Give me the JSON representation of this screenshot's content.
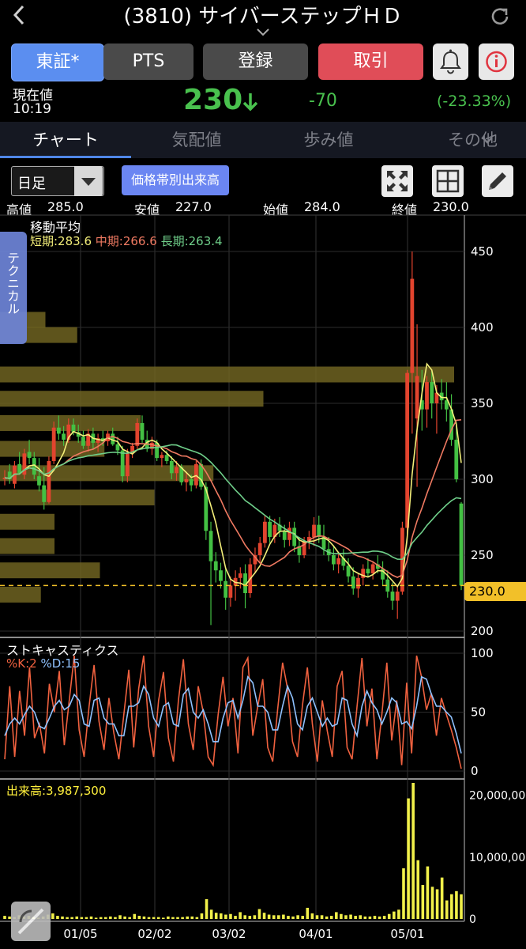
{
  "nav": {
    "back_icon": "chevron-left-icon",
    "title": "(3810) サイバーステップＨＤ",
    "refresh_icon": "refresh-icon",
    "expand_icon": "chevron-down-icon"
  },
  "market_buttons": {
    "tosho": "東証*",
    "pts": "PTS",
    "register": "登録",
    "trade": "取引"
  },
  "icons": {
    "bell": "bell-icon",
    "info": "info-icon"
  },
  "quote": {
    "label": "現在値",
    "time": "10:19",
    "price": "230",
    "direction": "down",
    "change": "-70",
    "change_pct": "(-23.33%)"
  },
  "tabs": [
    "チャート",
    "気配値",
    "歩み値",
    "その他"
  ],
  "toolbar": {
    "period": "日足",
    "volume_by_price": "価格帯別出来高"
  },
  "ohlc": {
    "high_label": "高値",
    "high": "285.0",
    "low_label": "安値",
    "low": "227.0",
    "open_label": "始値",
    "open": "284.0",
    "close_label": "終値",
    "close": "230.0"
  },
  "technical_tab": "テクニカル",
  "moving_average": {
    "title": "移動平均",
    "short": "短期:283.6",
    "mid": "中期:266.6",
    "long": "長期:263.4"
  },
  "stochastics": {
    "title": "ストキャスティクス",
    "k": "%K:2",
    "d": "%D:15"
  },
  "volume": {
    "title": "出来高:3,987,300"
  },
  "colors": {
    "up": "#e2442e",
    "down": "#43c043",
    "ma_short": "#f4ef7a",
    "ma_mid": "#f07a62",
    "ma_long": "#6fcf8a",
    "accent": "#5b8ef0",
    "volume_bar": "#f1f04a",
    "vp_bar": "#6f6321"
  },
  "chart_data": [
    {
      "type": "candlestick",
      "title": "",
      "ylim": [
        195,
        460
      ],
      "y_ticks": [
        "450",
        "400",
        "350",
        "300",
        "250",
        "200"
      ],
      "x_ticks": [
        "01/05",
        "02/02",
        "03/02",
        "04/01",
        "05/01"
      ],
      "current_price_label": "230.0",
      "candles": [
        {
          "o": 300,
          "h": 306,
          "l": 296,
          "c": 301
        },
        {
          "o": 305,
          "h": 310,
          "l": 297,
          "c": 300
        },
        {
          "o": 297,
          "h": 312,
          "l": 294,
          "c": 309
        },
        {
          "o": 310,
          "h": 318,
          "l": 303,
          "c": 304
        },
        {
          "o": 303,
          "h": 320,
          "l": 300,
          "c": 317
        },
        {
          "o": 318,
          "h": 326,
          "l": 310,
          "c": 314
        },
        {
          "o": 314,
          "h": 318,
          "l": 300,
          "c": 303
        },
        {
          "o": 302,
          "h": 314,
          "l": 292,
          "c": 296
        },
        {
          "o": 296,
          "h": 308,
          "l": 280,
          "c": 285
        },
        {
          "o": 285,
          "h": 315,
          "l": 284,
          "c": 312
        },
        {
          "o": 312,
          "h": 338,
          "l": 310,
          "c": 334
        },
        {
          "o": 334,
          "h": 342,
          "l": 326,
          "c": 330
        },
        {
          "o": 330,
          "h": 335,
          "l": 322,
          "c": 326
        },
        {
          "o": 326,
          "h": 340,
          "l": 324,
          "c": 336
        },
        {
          "o": 336,
          "h": 340,
          "l": 329,
          "c": 331
        },
        {
          "o": 331,
          "h": 336,
          "l": 324,
          "c": 328
        },
        {
          "o": 328,
          "h": 332,
          "l": 320,
          "c": 322
        },
        {
          "o": 322,
          "h": 333,
          "l": 318,
          "c": 330
        },
        {
          "o": 330,
          "h": 334,
          "l": 320,
          "c": 324
        },
        {
          "o": 324,
          "h": 330,
          "l": 318,
          "c": 327
        },
        {
          "o": 327,
          "h": 332,
          "l": 322,
          "c": 325
        },
        {
          "o": 325,
          "h": 332,
          "l": 322,
          "c": 330
        },
        {
          "o": 330,
          "h": 334,
          "l": 322,
          "c": 323
        },
        {
          "o": 323,
          "h": 328,
          "l": 316,
          "c": 319
        },
        {
          "o": 319,
          "h": 322,
          "l": 298,
          "c": 302
        },
        {
          "o": 302,
          "h": 320,
          "l": 298,
          "c": 317
        },
        {
          "o": 317,
          "h": 324,
          "l": 314,
          "c": 322
        },
        {
          "o": 322,
          "h": 340,
          "l": 320,
          "c": 337
        },
        {
          "o": 337,
          "h": 342,
          "l": 324,
          "c": 326
        },
        {
          "o": 326,
          "h": 332,
          "l": 318,
          "c": 320
        },
        {
          "o": 320,
          "h": 328,
          "l": 316,
          "c": 324
        },
        {
          "o": 324,
          "h": 326,
          "l": 312,
          "c": 314
        },
        {
          "o": 314,
          "h": 318,
          "l": 308,
          "c": 316
        },
        {
          "o": 316,
          "h": 319,
          "l": 310,
          "c": 312
        },
        {
          "o": 312,
          "h": 315,
          "l": 300,
          "c": 304
        },
        {
          "o": 304,
          "h": 312,
          "l": 299,
          "c": 308
        },
        {
          "o": 308,
          "h": 310,
          "l": 296,
          "c": 298
        },
        {
          "o": 298,
          "h": 305,
          "l": 292,
          "c": 300
        },
        {
          "o": 300,
          "h": 303,
          "l": 292,
          "c": 296
        },
        {
          "o": 296,
          "h": 312,
          "l": 294,
          "c": 310
        },
        {
          "o": 310,
          "h": 313,
          "l": 293,
          "c": 295
        },
        {
          "o": 295,
          "h": 298,
          "l": 260,
          "c": 266
        },
        {
          "o": 266,
          "h": 272,
          "l": 204,
          "c": 246
        },
        {
          "o": 246,
          "h": 252,
          "l": 232,
          "c": 240
        },
        {
          "o": 240,
          "h": 245,
          "l": 228,
          "c": 233
        },
        {
          "o": 233,
          "h": 242,
          "l": 214,
          "c": 222
        },
        {
          "o": 222,
          "h": 236,
          "l": 216,
          "c": 230
        },
        {
          "o": 230,
          "h": 240,
          "l": 220,
          "c": 235
        },
        {
          "o": 235,
          "h": 242,
          "l": 228,
          "c": 238
        },
        {
          "o": 238,
          "h": 244,
          "l": 215,
          "c": 225
        },
        {
          "o": 225,
          "h": 248,
          "l": 222,
          "c": 244
        },
        {
          "o": 244,
          "h": 255,
          "l": 238,
          "c": 250
        },
        {
          "o": 250,
          "h": 262,
          "l": 245,
          "c": 258
        },
        {
          "o": 258,
          "h": 276,
          "l": 255,
          "c": 272
        },
        {
          "o": 272,
          "h": 276,
          "l": 258,
          "c": 262
        },
        {
          "o": 262,
          "h": 274,
          "l": 258,
          "c": 270
        },
        {
          "o": 270,
          "h": 275,
          "l": 262,
          "c": 266
        },
        {
          "o": 266,
          "h": 270,
          "l": 255,
          "c": 260
        },
        {
          "o": 260,
          "h": 272,
          "l": 256,
          "c": 268
        },
        {
          "o": 268,
          "h": 272,
          "l": 252,
          "c": 256
        },
        {
          "o": 256,
          "h": 262,
          "l": 245,
          "c": 250
        },
        {
          "o": 250,
          "h": 262,
          "l": 248,
          "c": 259
        },
        {
          "o": 259,
          "h": 266,
          "l": 254,
          "c": 262
        },
        {
          "o": 262,
          "h": 275,
          "l": 256,
          "c": 270
        },
        {
          "o": 270,
          "h": 276,
          "l": 258,
          "c": 262
        },
        {
          "o": 262,
          "h": 270,
          "l": 250,
          "c": 254
        },
        {
          "o": 254,
          "h": 262,
          "l": 246,
          "c": 250
        },
        {
          "o": 250,
          "h": 256,
          "l": 240,
          "c": 244
        },
        {
          "o": 244,
          "h": 252,
          "l": 238,
          "c": 248
        },
        {
          "o": 248,
          "h": 254,
          "l": 240,
          "c": 243
        },
        {
          "o": 243,
          "h": 248,
          "l": 232,
          "c": 236
        },
        {
          "o": 236,
          "h": 242,
          "l": 224,
          "c": 228
        },
        {
          "o": 228,
          "h": 238,
          "l": 222,
          "c": 235
        },
        {
          "o": 235,
          "h": 244,
          "l": 230,
          "c": 241
        },
        {
          "o": 241,
          "h": 248,
          "l": 236,
          "c": 238
        },
        {
          "o": 238,
          "h": 246,
          "l": 234,
          "c": 244
        },
        {
          "o": 244,
          "h": 250,
          "l": 238,
          "c": 241
        },
        {
          "o": 241,
          "h": 246,
          "l": 230,
          "c": 234
        },
        {
          "o": 234,
          "h": 240,
          "l": 222,
          "c": 226
        },
        {
          "o": 226,
          "h": 232,
          "l": 214,
          "c": 220
        },
        {
          "o": 220,
          "h": 230,
          "l": 208,
          "c": 226
        },
        {
          "o": 226,
          "h": 272,
          "l": 224,
          "c": 268
        },
        {
          "o": 268,
          "h": 372,
          "l": 262,
          "c": 370
        },
        {
          "o": 370,
          "h": 450,
          "l": 330,
          "c": 432
        },
        {
          "o": 340,
          "h": 402,
          "l": 295,
          "c": 368
        },
        {
          "o": 352,
          "h": 372,
          "l": 332,
          "c": 346
        },
        {
          "o": 346,
          "h": 368,
          "l": 334,
          "c": 364
        },
        {
          "o": 364,
          "h": 372,
          "l": 340,
          "c": 350
        },
        {
          "o": 350,
          "h": 362,
          "l": 330,
          "c": 357
        },
        {
          "o": 357,
          "h": 366,
          "l": 346,
          "c": 352
        },
        {
          "o": 352,
          "h": 364,
          "l": 338,
          "c": 346
        },
        {
          "o": 346,
          "h": 356,
          "l": 322,
          "c": 326
        },
        {
          "o": 326,
          "h": 338,
          "l": 298,
          "c": 300
        },
        {
          "o": 284,
          "h": 285,
          "l": 227,
          "c": 230
        }
      ],
      "volume_by_price": [
        {
          "price": 405,
          "rel": 0.1
        },
        {
          "price": 395,
          "rel": 0.17
        },
        {
          "price": 369,
          "rel": 1.0
        },
        {
          "price": 353,
          "rel": 0.58
        },
        {
          "price": 337,
          "rel": 0.31
        },
        {
          "price": 320,
          "rel": 0.23
        },
        {
          "price": 304,
          "rel": 0.47
        },
        {
          "price": 288,
          "rel": 0.34
        },
        {
          "price": 272,
          "rel": 0.12
        },
        {
          "price": 256,
          "rel": 0.12
        },
        {
          "price": 240,
          "rel": 0.22
        },
        {
          "price": 224,
          "rel": 0.09
        }
      ]
    },
    {
      "type": "line",
      "title": "ストキャスティクス",
      "ylim": [
        0,
        100
      ],
      "y_ticks": [
        "100",
        "50",
        "0"
      ],
      "series": [
        {
          "name": "%K",
          "values": [
            10,
            72,
            12,
            68,
            30,
            88,
            28,
            40,
            15,
            74,
            50,
            85,
            22,
            60,
            98,
            35,
            12,
            55,
            90,
            42,
            18,
            62,
            32,
            10,
            48,
            86,
            20,
            70,
            98,
            38,
            12,
            60,
            84,
            28,
            8,
            60,
            95,
            40,
            18,
            72,
            50,
            12,
            5,
            48,
            80,
            38,
            62,
            15,
            88,
            96,
            30,
            55,
            78,
            20,
            8,
            52,
            92,
            70,
            25,
            12,
            56,
            88,
            40,
            8,
            60,
            34,
            12,
            72,
            85,
            20,
            10,
            55,
            96,
            38,
            70,
            10,
            48,
            92,
            26,
            60,
            5,
            75,
            15,
            98,
            80,
            52,
            66,
            30,
            62,
            48,
            35,
            20,
            2
          ]
        },
        {
          "name": "%D",
          "values": [
            30,
            40,
            45,
            40,
            48,
            55,
            50,
            38,
            36,
            45,
            55,
            60,
            52,
            55,
            65,
            60,
            40,
            38,
            60,
            62,
            45,
            40,
            40,
            30,
            30,
            55,
            55,
            58,
            72,
            65,
            45,
            38,
            55,
            58,
            40,
            38,
            65,
            70,
            50,
            45,
            52,
            40,
            25,
            25,
            45,
            58,
            60,
            45,
            60,
            80,
            75,
            55,
            55,
            50,
            35,
            35,
            55,
            72,
            62,
            40,
            35,
            55,
            62,
            50,
            38,
            45,
            38,
            40,
            62,
            60,
            40,
            30,
            55,
            68,
            58,
            52,
            40,
            50,
            62,
            58,
            40,
            42,
            36,
            55,
            80,
            78,
            65,
            55,
            55,
            50,
            46,
            32,
            15
          ]
        }
      ]
    },
    {
      "type": "bar",
      "title": "出来高",
      "ylim": [
        0,
        22000000
      ],
      "y_ticks": [
        "20,000,000",
        "10,000,000",
        "0"
      ],
      "values": [
        500000,
        400000,
        300000,
        600000,
        400000,
        500000,
        300000,
        200000,
        400000,
        700000,
        900000,
        500000,
        400000,
        300000,
        300000,
        400000,
        300000,
        300000,
        400000,
        200000,
        300000,
        300000,
        400000,
        300000,
        600000,
        400000,
        300000,
        800000,
        500000,
        400000,
        300000,
        300000,
        300000,
        200000,
        400000,
        300000,
        300000,
        300000,
        400000,
        400000,
        300000,
        900000,
        3200000,
        1500000,
        1000000,
        900000,
        700000,
        800000,
        500000,
        1100000,
        600000,
        500000,
        600000,
        1600000,
        1000000,
        700000,
        600000,
        600000,
        700000,
        500000,
        400000,
        600000,
        500000,
        1800000,
        900000,
        600000,
        600000,
        400000,
        500000,
        1100000,
        800000,
        600000,
        700000,
        500000,
        600000,
        400000,
        400000,
        500000,
        400000,
        500000,
        800000,
        1200000,
        1500000,
        8200000,
        19500000,
        22000000,
        9500000,
        5500000,
        8500000,
        5200000,
        4800000,
        6700000,
        3000000,
        4000000,
        4500000,
        3987300
      ]
    }
  ]
}
